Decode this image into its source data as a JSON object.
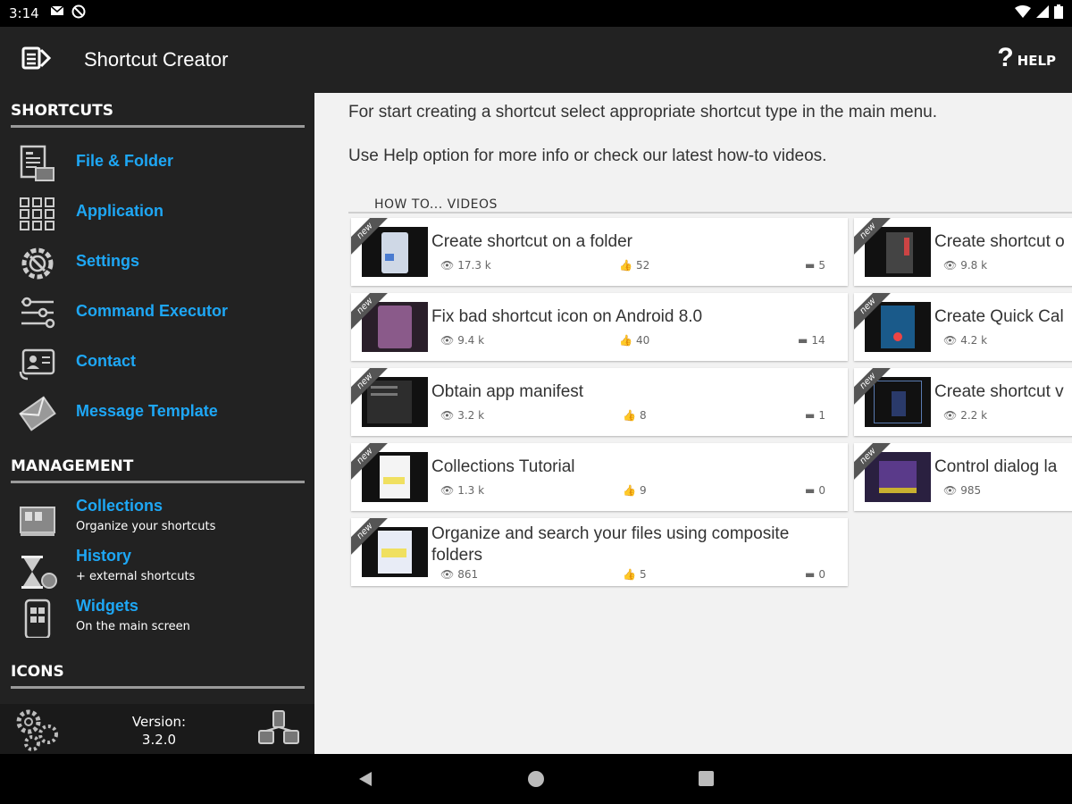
{
  "status": {
    "time": "3:14"
  },
  "app": {
    "title": "Shortcut Creator",
    "help_label": "HELP"
  },
  "sidebar": {
    "shortcuts_title": "SHORTCUTS",
    "shortcut_items": [
      {
        "label": "File & Folder",
        "icon": "file-folder-icon"
      },
      {
        "label": "Application",
        "icon": "application-icon"
      },
      {
        "label": "Settings",
        "icon": "settings-icon"
      },
      {
        "label": "Command Executor",
        "icon": "command-executor-icon"
      },
      {
        "label": "Contact",
        "icon": "contact-icon"
      },
      {
        "label": "Message Template",
        "icon": "message-template-icon"
      }
    ],
    "management_title": "MANAGEMENT",
    "management_items": [
      {
        "label": "Collections",
        "sub": "Organize your shortcuts",
        "icon": "collections-icon"
      },
      {
        "label": "History",
        "sub": "+ external shortcuts",
        "icon": "history-icon"
      },
      {
        "label": "Widgets",
        "sub": "On the main screen",
        "icon": "widgets-icon"
      }
    ],
    "icons_title": "ICONS",
    "version_label": "Version:",
    "version_value": "3.2.0"
  },
  "main": {
    "intro_line1": "For start creating a shortcut select appropriate shortcut type in the main menu.",
    "intro_line2": "Use Help option for more info or check our latest how-to videos.",
    "videos_header": "HOW TO... VIDEOS",
    "videos_left": [
      {
        "title": "Create shortcut on a folder",
        "views": "17.3 k",
        "likes": "52",
        "comments": "5"
      },
      {
        "title": "Fix bad shortcut icon on Android 8.0",
        "views": "9.4 k",
        "likes": "40",
        "comments": "14"
      },
      {
        "title": "Obtain app manifest",
        "views": "3.2 k",
        "likes": "8",
        "comments": "1"
      },
      {
        "title": "Collections Tutorial",
        "views": "1.3 k",
        "likes": "9",
        "comments": "0"
      },
      {
        "title": "Organize and search your files using composite folders",
        "views": "861",
        "likes": "5",
        "comments": "0"
      }
    ],
    "videos_right": [
      {
        "title": "Create shortcut o",
        "views": "9.8 k"
      },
      {
        "title": "Create Quick Cal",
        "views": "4.2 k"
      },
      {
        "title": "Create shortcut v",
        "views": "2.2 k"
      },
      {
        "title": "Control dialog la",
        "views": "985"
      }
    ],
    "new_badge": "new"
  },
  "colors": {
    "accent": "#1ea7f5",
    "sidebar_bg": "#222222",
    "main_bg": "#f2f2f2"
  }
}
